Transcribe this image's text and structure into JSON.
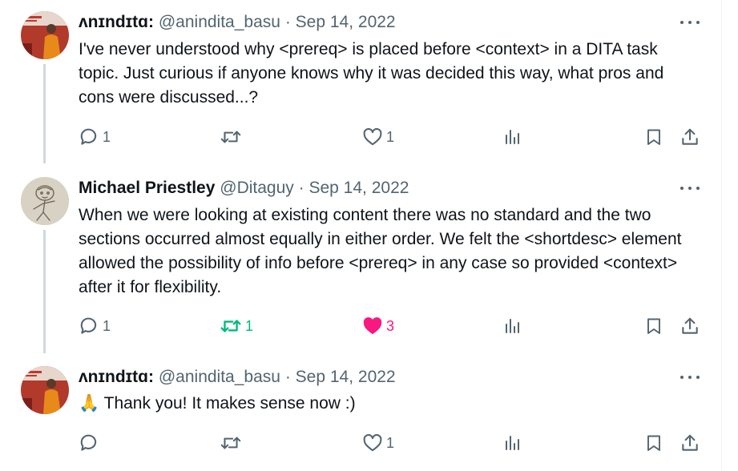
{
  "tweets": [
    {
      "name": "ʌnɪndɪtɑ",
      "name_suffix": ":",
      "handle": "@anindita_basu",
      "separator": "·",
      "date": "Sep 14, 2022",
      "text": "I've never understood why <prereq> is placed before <context> in a DITA task topic. Just curious if anyone knows why it was decided this way, what pros and cons were discussed...?",
      "emoji": "",
      "replies": "1",
      "retweets": "",
      "likes": "1",
      "retweeted": false,
      "liked": false
    },
    {
      "name": "Michael Priestley",
      "name_suffix": "",
      "handle": "@Ditaguy",
      "separator": "·",
      "date": "Sep 14, 2022",
      "text": "When we were looking at existing content there was no standard and the two sections occurred almost equally in either order. We felt the <shortdesc> element allowed the possibility of info before <prereq> in any case so provided <context> after it for flexibility.",
      "emoji": "",
      "replies": "1",
      "retweets": "1",
      "likes": "3",
      "retweeted": true,
      "liked": true
    },
    {
      "name": "ʌnɪndɪtɑ",
      "name_suffix": ":",
      "handle": "@anindita_basu",
      "separator": "·",
      "date": "Sep 14, 2022",
      "text": "Thank you! It makes sense now :)",
      "emoji": "🙏",
      "replies": "",
      "retweets": "",
      "likes": "1",
      "retweeted": false,
      "liked": false
    }
  ],
  "colors": {
    "text": "#0f1419",
    "secondary": "#536471",
    "retweet_active": "#00ba7c",
    "like_active": "#f91880",
    "thread_line": "#cfd9de"
  },
  "icons": [
    "reply-icon",
    "retweet-icon",
    "like-icon",
    "views-icon",
    "bookmark-icon",
    "share-icon",
    "more-icon"
  ]
}
